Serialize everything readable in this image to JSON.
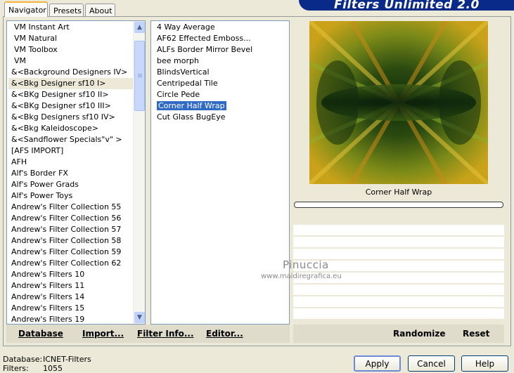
{
  "tabs": [
    "Navigator",
    "Presets",
    "About"
  ],
  "banner": "Filters Unlimited 2.0",
  "categories": [
    "VM Instant Art",
    "VM Natural",
    "VM Toolbox",
    "VM",
    "&<Background Designers IV>",
    "&<Bkg Designer sf10 I>",
    "&<BKg Designer sf10 II>",
    "&<BKg Designer sf10 III>",
    "&<Bkg Designers sf10 IV>",
    "&<Bkg Kaleidoscope>",
    "&<Sandflower Specials\"v\" >",
    "[AFS IMPORT]",
    "AFH",
    "Alf's Border FX",
    "Alf's Power Grads",
    "Alf's Power Toys",
    "Andrew's Filter Collection 55",
    "Andrew's Filter Collection 56",
    "Andrew's Filter Collection 57",
    "Andrew's Filter Collection 58",
    "Andrew's Filter Collection 59",
    "Andrew's Filter Collection 62",
    "Andrew's Filters 10",
    "Andrew's Filters 11",
    "Andrew's Filters 14",
    "Andrew's Filters 15",
    "Andrew's Filters 19"
  ],
  "filters": [
    "4 Way Average",
    "AF62 Effected Emboss...",
    "ALFs Border Mirror Bevel",
    "bee morph",
    "BlindsVertical",
    "Centripedal Tile",
    "Circle Pede",
    "Corner Half Wrap",
    "Cut Glass  BugEye"
  ],
  "preview_label": "Corner Half Wrap",
  "watermark": {
    "line1": "Pinuccia",
    "line2": "www.maidiregrafica.eu"
  },
  "links": {
    "database": "Database",
    "import": "Import...",
    "filter_info": "Filter Info...",
    "editor": "Editor..."
  },
  "actions": {
    "randomize": "Randomize",
    "reset": "Reset"
  },
  "status": {
    "database_label": "Database:",
    "database_value": "ICNET-Filters",
    "filters_label": "Filters:",
    "filters_value": "1055"
  },
  "buttons": {
    "apply": "Apply",
    "cancel": "Cancel",
    "help": "Help"
  },
  "colors": {
    "selection": "#316ac5",
    "banner": "#0a2a8a",
    "accent_tab": "#f4b238"
  }
}
